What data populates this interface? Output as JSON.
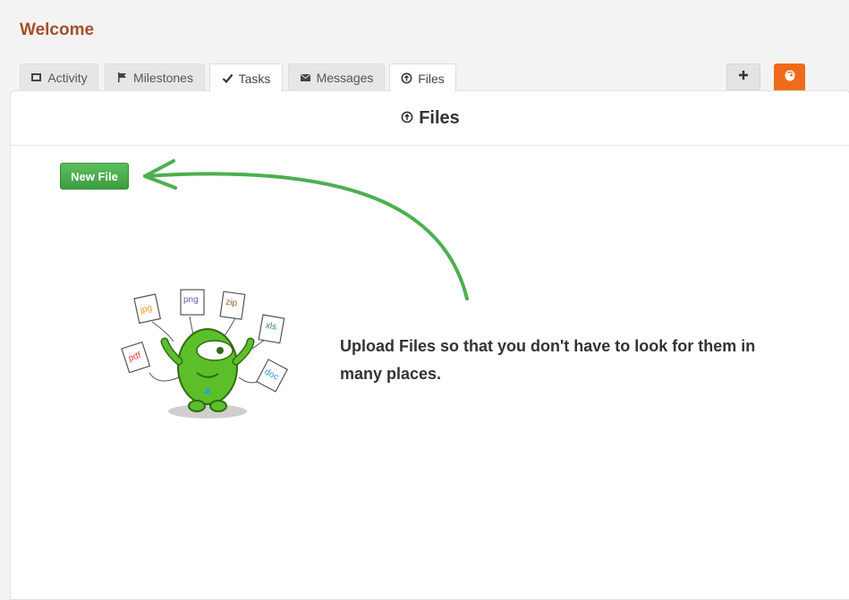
{
  "header": {
    "title": "Welcome"
  },
  "tabs": [
    {
      "label": "Activity",
      "icon": "film-icon"
    },
    {
      "label": "Milestones",
      "icon": "flag-icon"
    },
    {
      "label": "Tasks",
      "icon": "check-icon"
    },
    {
      "label": "Messages",
      "icon": "envelope-icon"
    },
    {
      "label": "Files",
      "icon": "upload-icon"
    }
  ],
  "toolbar": {
    "add_icon": "plus-icon",
    "brand_icon": "brand-icon"
  },
  "panel": {
    "title": "Files",
    "new_file_label": "New File",
    "hint": "Upload Files so that you don't have to look for them in many places."
  },
  "illustration": {
    "file_labels": [
      "jpg",
      "png",
      "zip",
      "xls",
      "pdf",
      "doc"
    ],
    "colors": {
      "jpg": "#f39c12",
      "png": "#6a5acd",
      "zip": "#8b5a2b",
      "xls": "#2e8b57",
      "pdf": "#e53935",
      "doc": "#29a3d8"
    }
  },
  "colors": {
    "accent": "#f06a1b",
    "title": "#a4502a",
    "green": "#4caf50"
  }
}
